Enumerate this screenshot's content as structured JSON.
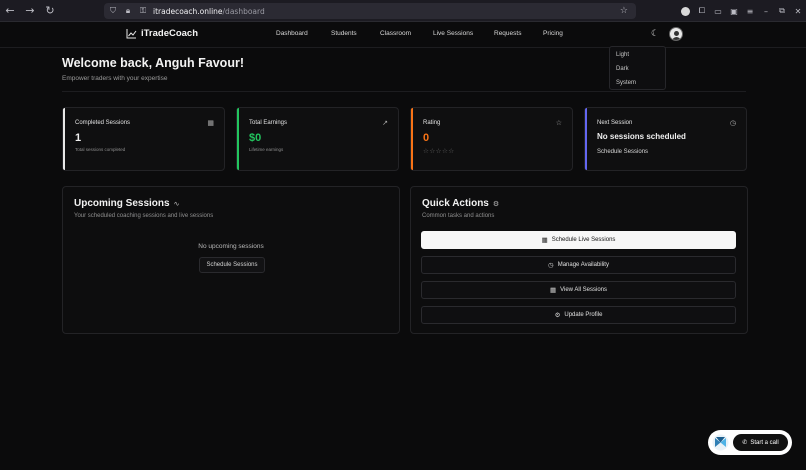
{
  "browser": {
    "url_host": "itradecoach.online",
    "url_path": "/dashboard",
    "nav": {
      "back": "←",
      "forward": "→",
      "reload": "↻"
    },
    "window_controls": {
      "minimize": "–",
      "restore": "⧉",
      "close": "✕"
    }
  },
  "app": {
    "brand": "iTradeCoach",
    "menu": [
      "Dashboard",
      "Students",
      "Classroom",
      "Live Sessions",
      "Requests",
      "Pricing"
    ],
    "theme_toggle_icon": "☾",
    "theme_menu": [
      "Light",
      "Dark",
      "System"
    ]
  },
  "welcome": {
    "title": "Welcome back, Anguh Favour!",
    "subtitle": "Empower traders with your expertise"
  },
  "stats": [
    {
      "title": "Completed Sessions",
      "value": "1",
      "sub": "Total sessions completed",
      "icon": "calendar-icon",
      "accent": "#e8e8e8"
    },
    {
      "title": "Total Earnings",
      "value": "$0",
      "sub": "Lifetime earnings",
      "icon": "trend-up-icon",
      "accent": "#22c55e",
      "value_color": "#22c55e"
    },
    {
      "title": "Rating",
      "value": "0",
      "stars": "☆☆☆☆☆",
      "icon": "star-icon",
      "accent": "#f97316",
      "value_color": "#f97316"
    },
    {
      "title": "Next Session",
      "value": "No sessions scheduled",
      "link": "Schedule Sessions",
      "icon": "clock-icon",
      "accent": "#6366f1"
    }
  ],
  "upcoming": {
    "title": "Upcoming Sessions",
    "subtitle": "Your scheduled coaching sessions and live sessions",
    "empty_text": "No upcoming sessions",
    "button": "Schedule Sessions"
  },
  "quick_actions": {
    "title": "Quick Actions",
    "subtitle": "Common tasks and actions",
    "buttons": [
      {
        "label": "Schedule Live Sessions",
        "icon": "calendar-icon"
      },
      {
        "label": "Manage Availability",
        "icon": "clock-icon"
      },
      {
        "label": "View All Sessions",
        "icon": "calendar-icon"
      },
      {
        "label": "Update Profile",
        "icon": "gear-icon"
      }
    ]
  },
  "call_widget": {
    "label": "Start a call"
  }
}
